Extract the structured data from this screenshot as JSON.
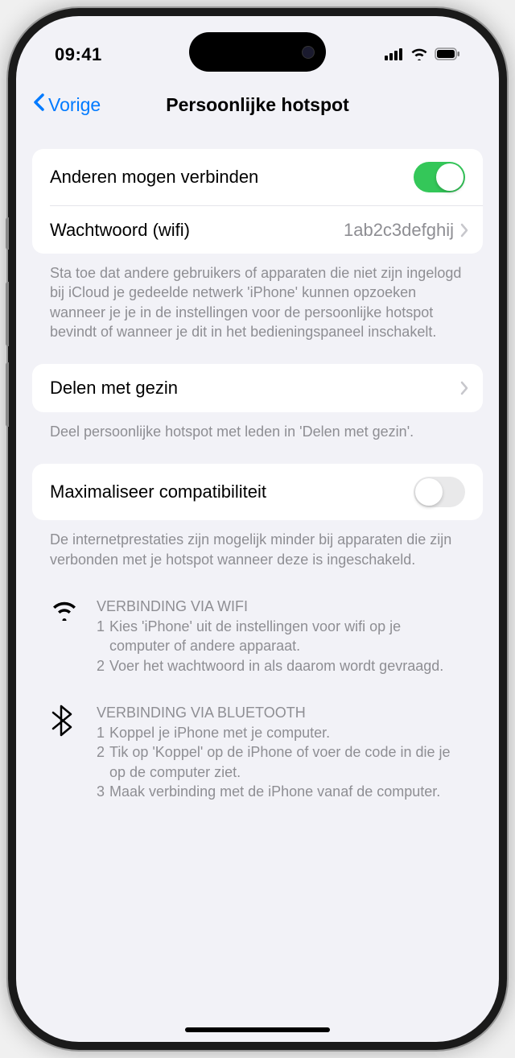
{
  "statusbar": {
    "time": "09:41"
  },
  "nav": {
    "back": "Vorige",
    "title": "Persoonlijke hotspot"
  },
  "allow_others": {
    "label": "Anderen mogen verbinden",
    "on": true
  },
  "wifi_password": {
    "label": "Wachtwoord (wifi)",
    "value": "1ab2c3defghij"
  },
  "allow_others_footer": "Sta toe dat andere gebruikers of apparaten die niet zijn ingelogd bij iCloud je gedeelde netwerk 'iPhone' kunnen opzoeken wanneer je je in de instellingen voor de persoonlijke hotspot bevindt of wanneer je dit in het bedieningspaneel inschakelt.",
  "family_sharing": {
    "label": "Delen met gezin",
    "footer": "Deel persoonlijke hotspot met leden in 'Delen met gezin'."
  },
  "maximize_compat": {
    "label": "Maximaliseer compatibiliteit",
    "on": false,
    "footer": "De internetprestaties zijn mogelijk minder bij apparaten die zijn verbonden met je hotspot wanneer deze is ingeschakeld."
  },
  "instructions": {
    "wifi": {
      "title": "VERBINDING VIA WIFI",
      "steps": [
        "Kies 'iPhone' uit de instellingen voor wifi op je computer of andere apparaat.",
        "Voer het wachtwoord in als daarom wordt gevraagd."
      ]
    },
    "bluetooth": {
      "title": "VERBINDING VIA BLUETOOTH",
      "steps": [
        "Koppel je iPhone met je computer.",
        "Tik op 'Koppel' op de iPhone of voer de code in die je op de computer ziet.",
        "Maak verbinding met de iPhone vanaf de computer."
      ]
    }
  }
}
